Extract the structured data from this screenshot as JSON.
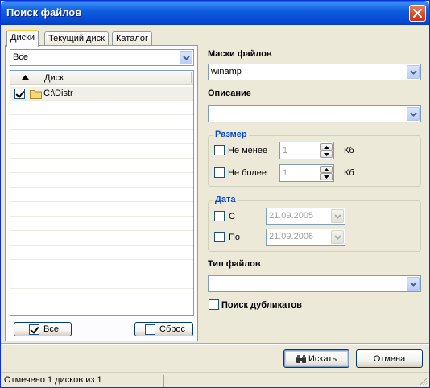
{
  "window": {
    "title": "Поиск файлов"
  },
  "tabs": [
    {
      "label": "Диски",
      "active": true
    },
    {
      "label": "Текущий диск",
      "active": false
    },
    {
      "label": "Каталог",
      "active": false
    }
  ],
  "drives": {
    "filter_value": "Все",
    "column_header": "Диск",
    "rows": [
      {
        "label": "C:\\Distr",
        "checked": true
      }
    ],
    "select_all_label": "Все",
    "reset_label": "Сброс"
  },
  "masks": {
    "label": "Маски файлов",
    "value": "winamp"
  },
  "description": {
    "label": "Описание",
    "value": ""
  },
  "size": {
    "title": "Размер",
    "min": {
      "label": "Не менее",
      "value": "1",
      "unit": "Кб",
      "checked": false
    },
    "max": {
      "label": "Не более",
      "value": "1",
      "unit": "Кб",
      "checked": false
    }
  },
  "date": {
    "title": "Дата",
    "from": {
      "label": "С",
      "value": "21.09.2005",
      "checked": false
    },
    "to": {
      "label": "По",
      "value": "21.09.2006",
      "checked": false
    }
  },
  "filetype": {
    "label": "Тип файлов",
    "value": ""
  },
  "duplicates": {
    "label": "Поиск дубликатов",
    "checked": false
  },
  "buttons": {
    "search_label": "Искать",
    "cancel_label": "Отмена"
  },
  "status": {
    "text": "Отмечено 1 дисков из 1"
  },
  "colors": {
    "titlebar": "#0a5fd9",
    "group_title": "#0046d5",
    "dialog_bg": "#ece9d8"
  },
  "icons": [
    "close-icon",
    "sort-ascending-icon",
    "folder-icon",
    "binoculars-icon",
    "chevron-down-icon",
    "spin-up-icon",
    "spin-down-icon",
    "size-grip-icon"
  ]
}
